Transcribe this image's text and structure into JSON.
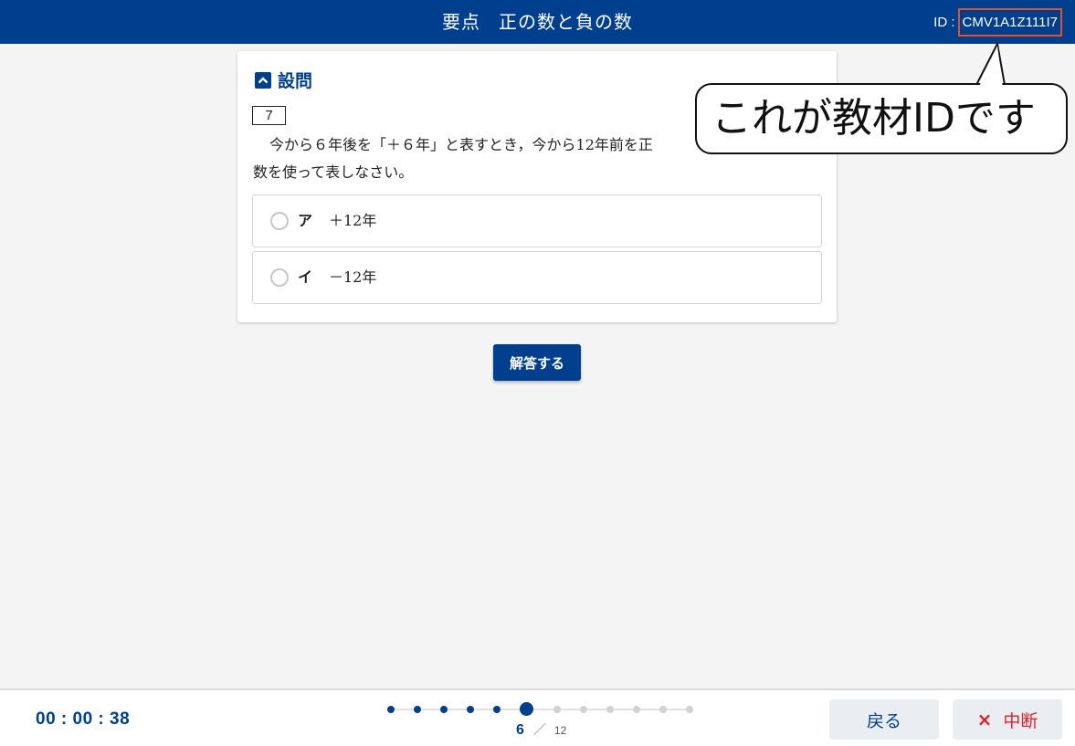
{
  "header": {
    "title_part1": "要点",
    "title_part2": "正の数と負の数",
    "id_label": "ID :",
    "id_value": "CMV1A1Z111I7"
  },
  "callout": {
    "text": "これが教材IDです"
  },
  "question_card": {
    "section_label": "設問",
    "question_number": "7",
    "text_line1": "今から６年後を「＋６年」と表すとき，今から12年前を正",
    "text_line2": "数を使って表しなさい。",
    "options": [
      {
        "letter": "ア",
        "text": "＋12年"
      },
      {
        "letter": "イ",
        "text": "－12年"
      }
    ]
  },
  "answer_button": {
    "label": "解答する"
  },
  "footer": {
    "timer": "00 : 00 : 38",
    "progress": {
      "current": "6",
      "separator": "／",
      "total": "12"
    },
    "back_label": "戻る",
    "quit_icon": "×",
    "quit_label": "中断"
  },
  "colors": {
    "brand": "#003f8e",
    "highlight": "#e0522c",
    "quit": "#e0202a"
  }
}
